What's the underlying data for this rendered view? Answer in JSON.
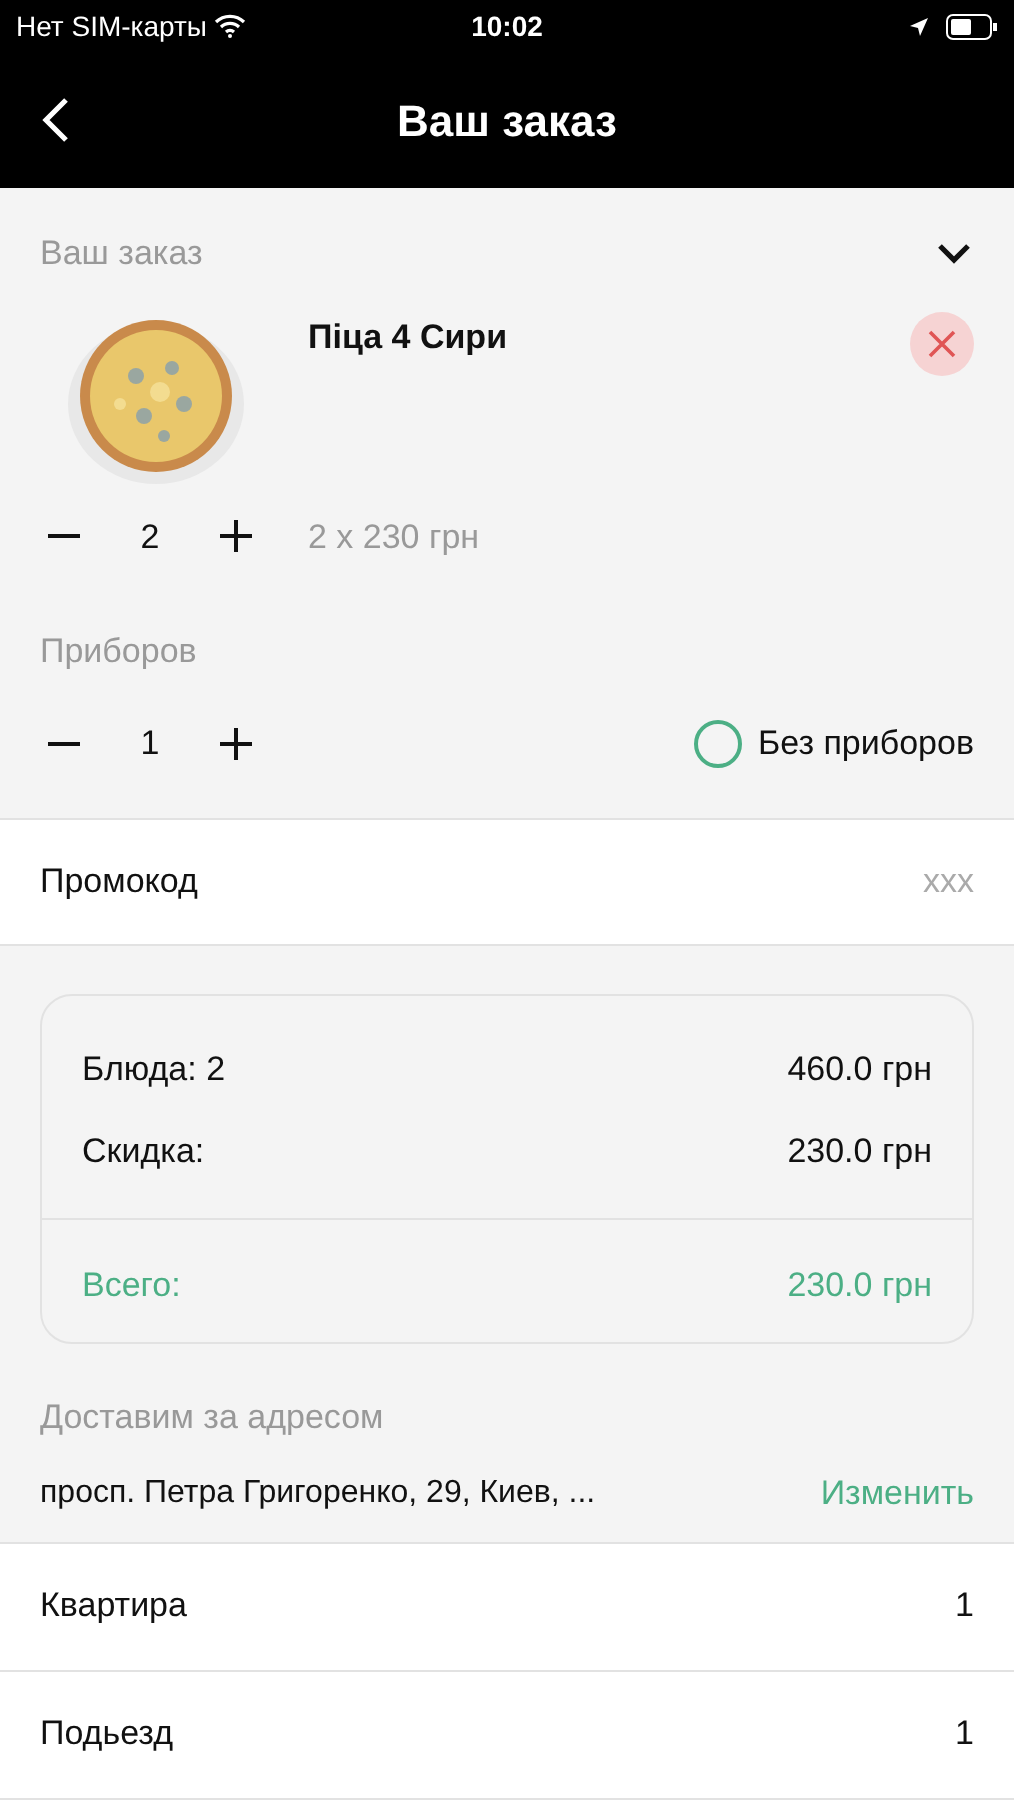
{
  "status_bar": {
    "carrier": "Нет SIM-карты",
    "time": "10:02"
  },
  "nav": {
    "title": "Ваш заказ"
  },
  "order": {
    "title": "Ваш заказ",
    "expanded": true,
    "items": [
      {
        "name": "Піца 4 Сири",
        "quantity": "2",
        "price": "2 x 230 грн"
      }
    ]
  },
  "cutlery": {
    "title": "Приборов",
    "quantity": "1",
    "none_label": "Без приборов",
    "none_selected": false
  },
  "promo": {
    "label": "Промокод",
    "placeholder": "xxx"
  },
  "summary": [
    {
      "label": "Блюда: 2",
      "value": "460.0 грн",
      "total": false
    },
    {
      "label": "Скидка:",
      "value": "230.0 грн",
      "total": false
    },
    {
      "label": "Всего:",
      "value": "230.0 грн",
      "total": true
    }
  ],
  "delivery": {
    "title": "Доставим за адресом",
    "address": "просп. Петра Григоренко, 29, Киев, ...",
    "change": "Изменить"
  },
  "fields": [
    {
      "label": "Квартира",
      "value": "1"
    },
    {
      "label": "Подьезд",
      "value": "1"
    }
  ]
}
